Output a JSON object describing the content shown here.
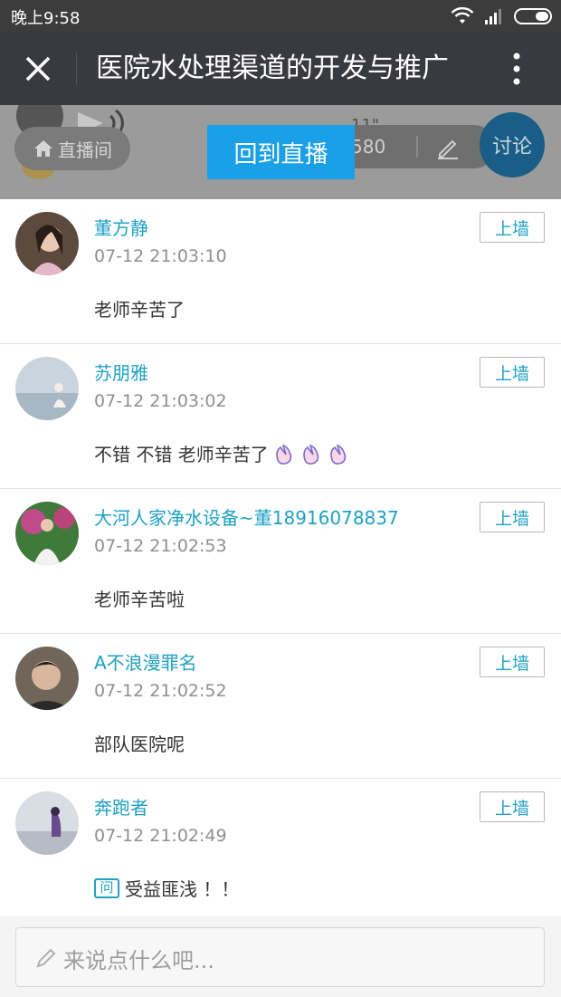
{
  "status_bar": {
    "time": "晚上9:58"
  },
  "header": {
    "title": "医院水处理渠道的开发与推广"
  },
  "live": {
    "home_label": "直播间",
    "duration_fragment": "11\"",
    "view_count": "580",
    "back_to_live_label": "回到直播",
    "discuss_label": "讨论"
  },
  "comments": [
    {
      "name": "董方静",
      "time": "07-12 21:03:10",
      "text": "老师辛苦了",
      "wall_label": "上墙"
    },
    {
      "name": "苏朋雅",
      "time": "07-12 21:03:02",
      "text": "不错 不错 老师辛苦了",
      "wall_label": "上墙"
    },
    {
      "name": "大河人家净水设备~董18916078837",
      "time": "07-12 21:02:53",
      "text": "老师辛苦啦",
      "wall_label": "上墙"
    },
    {
      "name": "A不浪漫罪名",
      "time": "07-12 21:02:52",
      "text": "部队医院呢",
      "wall_label": "上墙"
    },
    {
      "name": "奔跑者",
      "time": "07-12 21:02:49",
      "text": "受益匪浅 ！！",
      "badge": "问",
      "wall_label": "上墙"
    }
  ],
  "input": {
    "placeholder": "来说点什么吧..."
  },
  "colors": {
    "accent": "#1fa1c4",
    "live_button": "#1aa0e6",
    "header_bg": "#393a3f"
  }
}
